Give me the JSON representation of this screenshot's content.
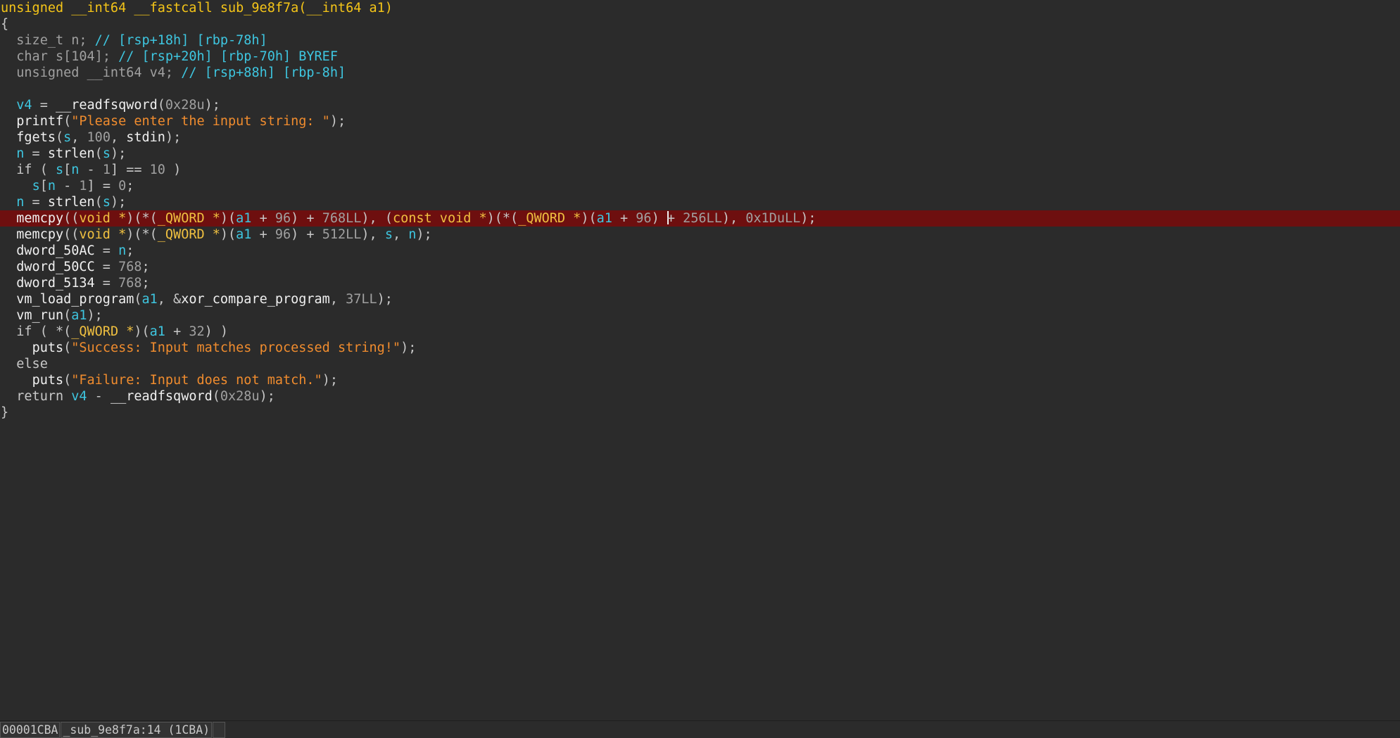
{
  "code": {
    "signature": "unsigned __int64 __fastcall sub_9e8f7a(__int64 a1)",
    "open_brace": "{",
    "close_brace": "}",
    "decl": [
      {
        "type": "size_t",
        "name": "n",
        "comment": "// [rsp+18h] [rbp-78h]"
      },
      {
        "type": "char",
        "name": "s[104]",
        "comment": "// [rsp+20h] [rbp-70h] BYREF"
      },
      {
        "type": "unsigned __int64",
        "name": "v4",
        "comment": "// [rsp+88h] [rbp-8h]"
      }
    ],
    "strings": {
      "prompt": "\"Please enter the input string: \"",
      "success": "\"Success: Input matches processed string!\"",
      "failure": "\"Failure: Input does not match.\""
    },
    "highlighted_line": 13
  },
  "status_bar": {
    "address": "00001CBA",
    "location": "_sub_9e8f7a:14 (1CBA)",
    "extra": ""
  },
  "colors": {
    "background": "#2b2b2b",
    "highlight": "#6e0f0f",
    "signature": "#f5c518",
    "variable": "#3ec6e0",
    "type": "#f0c040",
    "string": "#f08c2e",
    "number": "#a0a0a0"
  }
}
